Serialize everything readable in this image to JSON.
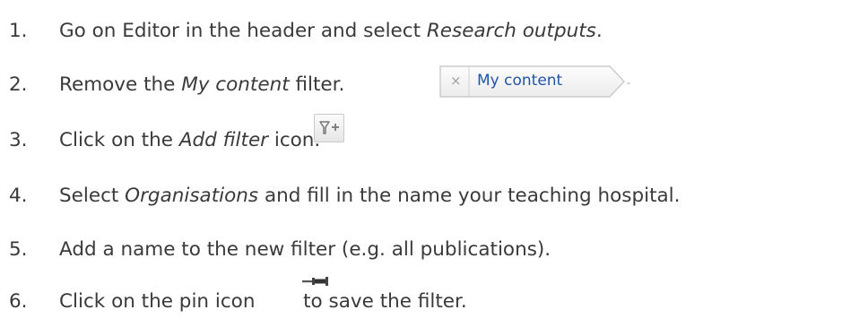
{
  "steps": [
    {
      "number": "1.",
      "pre": "Go on Editor in the header and select ",
      "em": "Research outputs",
      "post": "."
    },
    {
      "number": "2.",
      "pre": "Remove the ",
      "em": "My content",
      "post": " filter."
    },
    {
      "number": "3.",
      "pre": "Click on the ",
      "em": "Add filter",
      "post": " icon."
    },
    {
      "number": "4.",
      "pre": "Select ",
      "em": "Organisations",
      "post": " and fill in the name your teaching hospital."
    },
    {
      "number": "5.",
      "text": "Add a name to the new filter (e.g. all publications)."
    },
    {
      "number": "6.",
      "pre": "Click on the pin icon ",
      "post": " to save the filter."
    }
  ],
  "filter_chip": {
    "remove_glyph": "×",
    "label": "My content"
  },
  "icons": {
    "add_filter": "add-filter-icon",
    "pin": "pin-icon"
  },
  "colors": {
    "text": "#3a3a3a",
    "chip_label": "#2255a4"
  }
}
